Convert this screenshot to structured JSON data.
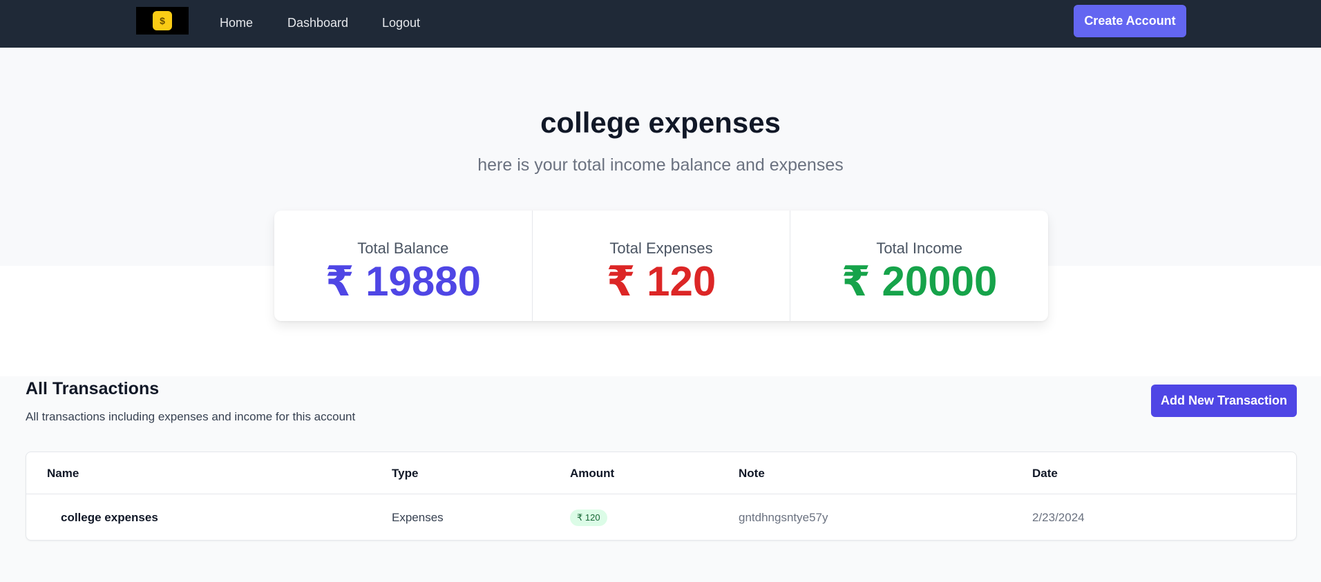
{
  "nav": {
    "links": [
      "Home",
      "Dashboard",
      "Logout"
    ],
    "create_account": "Create Account"
  },
  "hero": {
    "title": "college expenses",
    "subtitle": "here is your total income balance and expenses"
  },
  "stats": {
    "balance": {
      "label": "Total Balance",
      "value": "₹ 19880"
    },
    "expenses": {
      "label": "Total Expenses",
      "value": "₹ 120"
    },
    "income": {
      "label": "Total Income",
      "value": "₹ 20000"
    }
  },
  "transactions": {
    "title": "All Transactions",
    "subtitle": "All transactions including expenses and income for this account",
    "add_button": "Add New Transaction",
    "columns": [
      "Name",
      "Type",
      "Amount",
      "Note",
      "Date"
    ],
    "rows": [
      {
        "name": "college expenses",
        "type": "Expenses",
        "amount": "₹ 120",
        "note": "gntdhngsntye57y",
        "date": "2/23/2024"
      }
    ]
  },
  "colors": {
    "navbar": "#1f2937",
    "primary": "#6366f1",
    "balance": "#4f46e5",
    "expenses": "#dc2626",
    "income": "#16a34a"
  },
  "icons": {
    "logo": "money-bag-icon"
  }
}
